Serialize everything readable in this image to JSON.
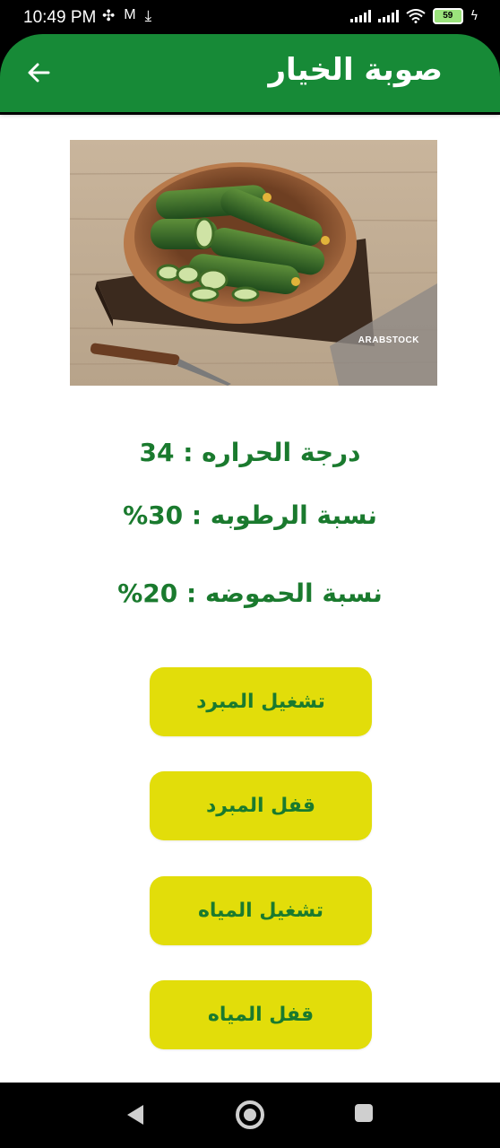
{
  "status_bar": {
    "time": "10:49 PM",
    "battery": "59",
    "icons": [
      "fan-icon",
      "gmail-icon",
      "download-icon",
      "signal-icon",
      "signal-icon",
      "wifi-icon",
      "battery-icon",
      "charging-icon"
    ]
  },
  "app_bar": {
    "title": "صوبة الخيار",
    "back_icon": "arrow-back-icon",
    "color": "#178a37"
  },
  "image": {
    "subject": "cucumbers in wooden bowl",
    "watermark": "ARABSTOCK"
  },
  "readings": {
    "temperature": "درجة الحراره : 34",
    "humidity": "نسبة الرطوبه : 30%",
    "acidity": "نسبة الحموضه : 20%"
  },
  "buttons": {
    "cooler_on": "تشغيل المبرد",
    "cooler_off": "قفل المبرد",
    "water_on": "تشغيل المياه",
    "water_off": "قفل المياه",
    "color": "#e2dd0a",
    "text_color": "#1a7a2e"
  },
  "nav_bar": {
    "back_icon": "nav-back-icon",
    "home_icon": "nav-home-icon",
    "recents_icon": "nav-recents-icon"
  }
}
